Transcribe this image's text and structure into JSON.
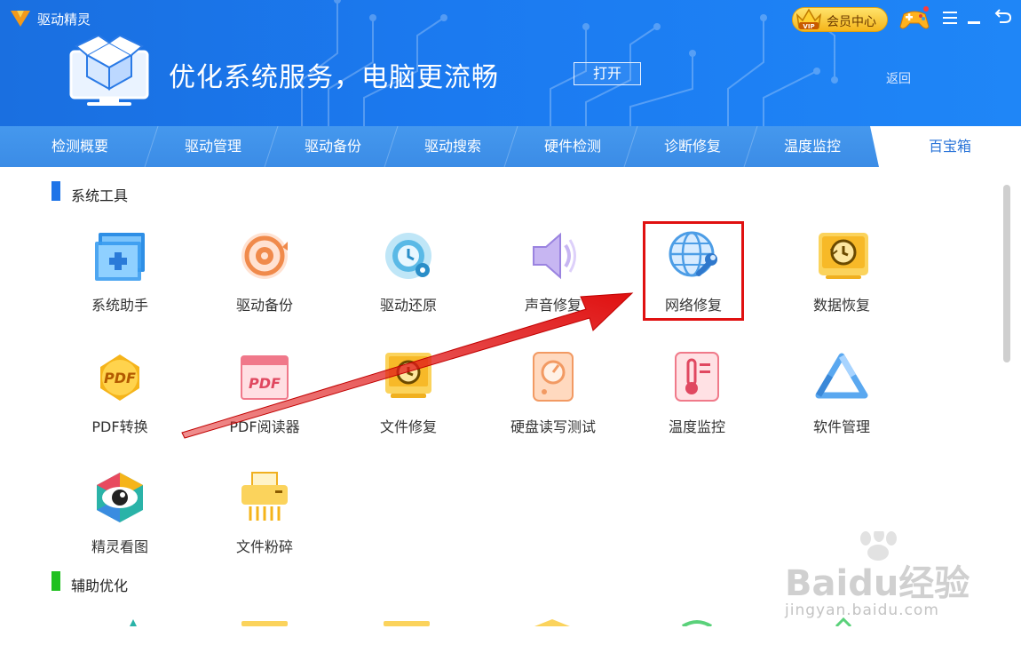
{
  "window": {
    "app_title": "驱动精灵",
    "vip_label": "会员中心",
    "vip_badge_text": "VIP"
  },
  "hero": {
    "headline": "优化系统服务，电脑更流畅",
    "open_button": "打开",
    "back_link": "返回"
  },
  "tabs": [
    {
      "label": "检测概要"
    },
    {
      "label": "驱动管理"
    },
    {
      "label": "驱动备份"
    },
    {
      "label": "驱动搜索"
    },
    {
      "label": "硬件检测"
    },
    {
      "label": "诊断修复"
    },
    {
      "label": "温度监控"
    },
    {
      "label": "百宝箱",
      "active": true
    }
  ],
  "sections": {
    "system_tools": {
      "title": "系统工具",
      "accent": "#1e74e8"
    },
    "aux_optimize": {
      "title": "辅助优化",
      "accent": "#20c020"
    }
  },
  "tools": [
    {
      "label": "系统助手",
      "icon": "system-assistant-icon"
    },
    {
      "label": "驱动备份",
      "icon": "driver-backup-icon"
    },
    {
      "label": "驱动还原",
      "icon": "driver-restore-icon"
    },
    {
      "label": "声音修复",
      "icon": "sound-repair-icon"
    },
    {
      "label": "网络修复",
      "icon": "network-repair-icon",
      "highlighted": true
    },
    {
      "label": "数据恢复",
      "icon": "data-recovery-icon"
    },
    {
      "label": "PDF转换",
      "icon": "pdf-convert-icon",
      "icon_text": "PDF"
    },
    {
      "label": "PDF阅读器",
      "icon": "pdf-reader-icon",
      "icon_text": "PDF"
    },
    {
      "label": "文件修复",
      "icon": "file-repair-icon"
    },
    {
      "label": "硬盘读写测试",
      "icon": "disk-test-icon"
    },
    {
      "label": "温度监控",
      "icon": "temperature-monitor-icon"
    },
    {
      "label": "软件管理",
      "icon": "software-manager-icon"
    },
    {
      "label": "精灵看图",
      "icon": "image-viewer-icon"
    },
    {
      "label": "文件粉碎",
      "icon": "file-shredder-icon"
    }
  ],
  "watermark": {
    "brand": "Baidu经验",
    "url": "jingyan.baidu.com"
  },
  "colors": {
    "header_blue": "#1b7af0",
    "tab_blue": "#3b8ce6",
    "highlight_red": "#e01010",
    "arrow_red": "#e01010"
  }
}
